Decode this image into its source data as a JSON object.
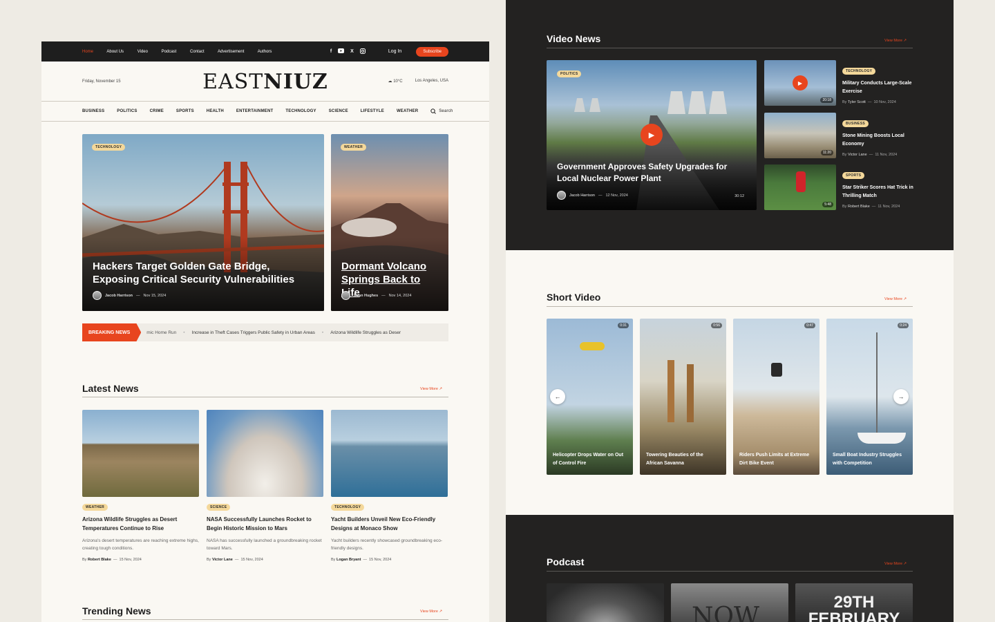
{
  "topbar": {
    "nav": [
      "Home",
      "About Us",
      "Video",
      "Podcast",
      "Contact",
      "Advertisement",
      "Authors"
    ],
    "login": "Log In",
    "subscribe": "Subscribe"
  },
  "masthead": {
    "date": "Friday, November 15",
    "logo_light": "EAST",
    "logo_bold": "NIUZ",
    "weather": "10°C",
    "location": "Los Angeles, USA"
  },
  "categories": [
    "BUSINESS",
    "POLITICS",
    "CRIME",
    "SPORTS",
    "HEALTH",
    "ENTERTAINMENT",
    "TECHNOLOGY",
    "SCIENCE",
    "LIFESTYLE",
    "WEATHER"
  ],
  "search_label": "Search",
  "hero": [
    {
      "badge": "TECHNOLOGY",
      "title": "Hackers Target Golden Gate Bridge, Exposing Critical Security Vulnerabilities",
      "author": "Jacob Harrison",
      "date": "Nov 15, 2024"
    },
    {
      "badge": "WEATHER",
      "title": "Dormant Volcano Springs Back to Life",
      "author": "Ryan Hughes",
      "date": "Nov 14, 2024"
    }
  ],
  "ticker": {
    "label": "BREAKING NEWS",
    "items": [
      "mic Home Run",
      "Increase in Theft Cases Triggers Public Safety in Urban Areas",
      "Arizona Wildlife Struggles as Deser"
    ]
  },
  "latest": {
    "title": "Latest News",
    "view_more": "View More ↗",
    "items": [
      {
        "badge": "WEATHER",
        "title": "Arizona Wildlife Struggles as Desert Temperatures Continue to Rise",
        "excerpt": "Arizona's desert temperatures are reaching extreme highs, creating tough conditions.",
        "by": "By",
        "author": "Robert Blake",
        "date": "15 Nov, 2024"
      },
      {
        "badge": "SCIENCE",
        "title": "NASA Successfully Launches Rocket to Begin Historic Mission to Mars",
        "excerpt": "NASA has successfully launched a groundbreaking rocket toward Mars.",
        "by": "By",
        "author": "Victor Lane",
        "date": "15 Nov, 2024"
      },
      {
        "badge": "TECHNOLOGY",
        "title": "Yacht Builders Unveil New Eco-Friendly Designs at Monaco Show",
        "excerpt": "Yacht builders recently showcased groundbreaking eco-friendly designs.",
        "by": "By",
        "author": "Logan Bryant",
        "date": "15 Nov, 2024"
      }
    ]
  },
  "trending": {
    "title": "Trending News",
    "view_more": "View More ↗"
  },
  "video_news": {
    "title": "Video News",
    "view_more": "View More ↗",
    "main": {
      "badge": "POLITICS",
      "title": "Government Approves Safety Upgrades for Local Nuclear Power Plant",
      "author": "Jacob Harrison",
      "date": "12 Nov, 2024",
      "duration": "30:12"
    },
    "side": [
      {
        "badge": "TECHNOLOGY",
        "title": "Military Conducts Large-Scale Exercise",
        "by": "By",
        "author": "Tyler Scott",
        "date": "10 Nov, 2024",
        "duration": "20:18"
      },
      {
        "badge": "BUSINESS",
        "title": "Stone Mining Boosts Local Economy",
        "by": "By",
        "author": "Victor Lane",
        "date": "11 Nov, 2024",
        "duration": "11:20"
      },
      {
        "badge": "SPORTS",
        "title": "Star Striker Scores Hat Trick in Thrilling Match",
        "by": "By",
        "author": "Robert Blake",
        "date": "11 Nov, 2024",
        "duration": "5:48"
      }
    ]
  },
  "short_video": {
    "title": "Short Video",
    "view_more": "View More ↗",
    "items": [
      {
        "duration": "0:31",
        "caption": "Helicopter Drops Water on Out of Control Fire"
      },
      {
        "duration": "0:56",
        "caption": "Towering Beauties of the African Savanna"
      },
      {
        "duration": "0:47",
        "caption": "Riders Push Limits at Extreme Dirt Bike Event"
      },
      {
        "duration": "0:24",
        "caption": "Small Boat Industry Struggles with Competition"
      }
    ]
  },
  "podcast": {
    "title": "Podcast",
    "view_more": "View More ↗",
    "covers": [
      "",
      "NOW",
      "29TH FEBRUARY"
    ]
  },
  "colors": {
    "accent": "#e8451e",
    "dark": "#232221",
    "paper": "#faf8f3",
    "badge": "#f4d89a"
  }
}
